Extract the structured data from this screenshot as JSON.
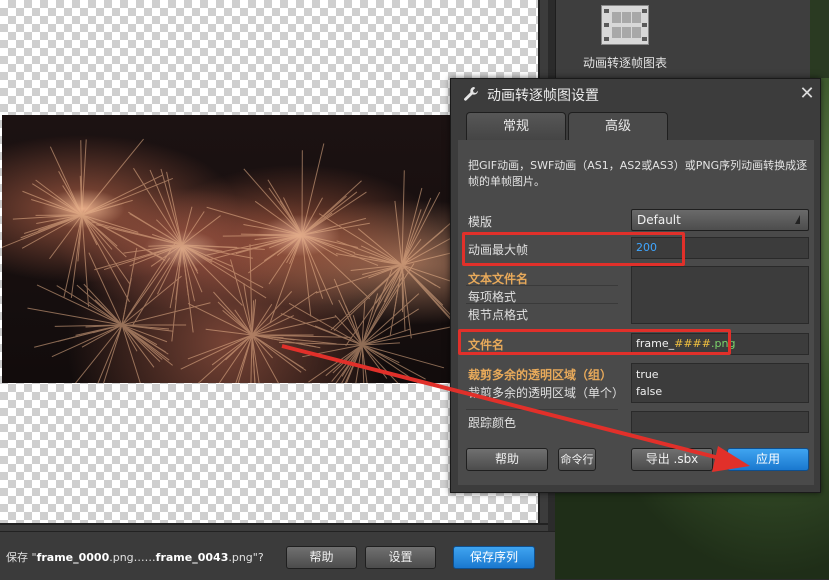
{
  "right_panel": {
    "film_label": "动画转逐帧图表"
  },
  "dialog": {
    "title": "动画转逐帧图设置",
    "close": "✕",
    "tabs": [
      {
        "label": "常规",
        "active": false
      },
      {
        "label": "高级",
        "active": true
      }
    ],
    "description": "把GIF动画，SWF动画（AS1，AS2或AS3）或PNG序列动画转换成逐帧的单帧图片。",
    "fields": {
      "template_label": "模版",
      "template_value": "Default",
      "max_frame_label": "动画最大帧",
      "max_frame_value": "200",
      "text_file_label": "文本文件名",
      "item_format_label": "每项格式",
      "root_format_label": "根节点格式",
      "filename_label": "文件名",
      "filename_prefix": "frame_",
      "filename_hash": "####",
      "filename_ext": ".png",
      "crop_group_label": "裁剪多余的透明区域（组）",
      "crop_single_label": "裁剪多余的透明区域（单个）",
      "crop_group_value": "true",
      "crop_single_value": "false",
      "trace_color_label": "跟踪颜色"
    },
    "buttons": {
      "help": "帮助",
      "command_line": "命令行",
      "export_sbx": "导出 .sbx",
      "apply": "应用"
    }
  },
  "bottom_bar": {
    "status_pre": "保存 \"",
    "status_first": "frame_0000",
    "status_mid": ".png……",
    "status_last": "frame_0043",
    "status_post": ".png\"?",
    "help": "帮助",
    "settings": "设置",
    "save_sequence": "保存序列"
  },
  "colors": {
    "accent_blue": "#1a78cf",
    "highlight_red": "#e1302a",
    "label_orange": "#e7a95a",
    "max_frame_blue": "#3fa6ff",
    "ext_green": "#7bd46b"
  }
}
